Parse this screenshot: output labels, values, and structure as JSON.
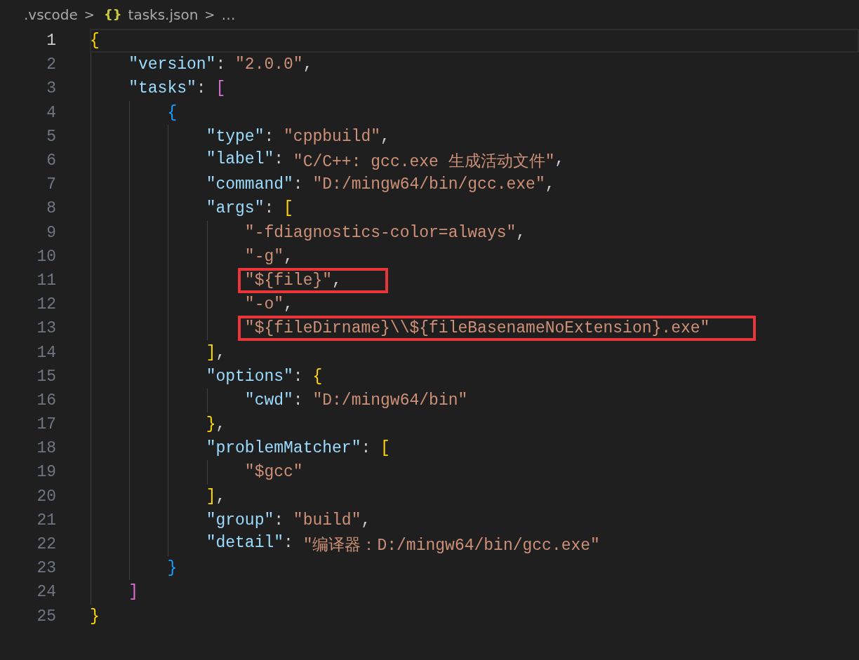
{
  "breadcrumb": {
    "folder": ".vscode",
    "separator_1": ">",
    "file_icon": "{}",
    "file": "tasks.json",
    "separator_2": ">",
    "more": "…"
  },
  "lines": [
    {
      "number": "1",
      "active": true,
      "highlighted": false,
      "tokens": [
        {
          "kind": "bracket",
          "text": "{",
          "color": "#ffd700"
        }
      ],
      "children": [
        {
          "number": "2",
          "active": false,
          "highlighted": false,
          "tokens": [
            {
              "kind": "key",
              "text": "\"version\""
            },
            {
              "kind": "punct",
              "text": ": "
            },
            {
              "kind": "string",
              "text": "\"2.0.0\""
            },
            {
              "kind": "punct",
              "text": ","
            }
          ]
        },
        {
          "number": "3",
          "active": false,
          "highlighted": false,
          "tokens": [
            {
              "kind": "key",
              "text": "\"tasks\""
            },
            {
              "kind": "punct",
              "text": ": "
            },
            {
              "kind": "bracket",
              "text": "[",
              "color": "#da70d6"
            }
          ],
          "children": [
            {
              "number": "4",
              "active": false,
              "highlighted": false,
              "tokens": [
                {
                  "kind": "bracket",
                  "text": "{",
                  "color": "#179fff"
                }
              ],
              "children": [
                {
                  "number": "5",
                  "active": false,
                  "highlighted": false,
                  "tokens": [
                    {
                      "kind": "key",
                      "text": "\"type\""
                    },
                    {
                      "kind": "punct",
                      "text": ": "
                    },
                    {
                      "kind": "string",
                      "text": "\"cppbuild\""
                    },
                    {
                      "kind": "punct",
                      "text": ","
                    }
                  ]
                },
                {
                  "number": "6",
                  "active": false,
                  "highlighted": false,
                  "tokens": [
                    {
                      "kind": "key",
                      "text": "\"label\""
                    },
                    {
                      "kind": "punct",
                      "text": ": "
                    },
                    {
                      "kind": "string",
                      "text": "\"C/C++: gcc.exe 生成活动文件\""
                    },
                    {
                      "kind": "punct",
                      "text": ","
                    }
                  ]
                },
                {
                  "number": "7",
                  "active": false,
                  "highlighted": false,
                  "tokens": [
                    {
                      "kind": "key",
                      "text": "\"command\""
                    },
                    {
                      "kind": "punct",
                      "text": ": "
                    },
                    {
                      "kind": "string",
                      "text": "\"D:/mingw64/bin/gcc.exe\""
                    },
                    {
                      "kind": "punct",
                      "text": ","
                    }
                  ]
                },
                {
                  "number": "8",
                  "active": false,
                  "highlighted": false,
                  "tokens": [
                    {
                      "kind": "key",
                      "text": "\"args\""
                    },
                    {
                      "kind": "punct",
                      "text": ": "
                    },
                    {
                      "kind": "bracket",
                      "text": "[",
                      "color": "#ffd700"
                    }
                  ],
                  "children": [
                    {
                      "number": "9",
                      "active": false,
                      "highlighted": false,
                      "tokens": [
                        {
                          "kind": "string",
                          "text": "\"-fdiagnostics-color=always\""
                        },
                        {
                          "kind": "punct",
                          "text": ","
                        }
                      ]
                    },
                    {
                      "number": "10",
                      "active": false,
                      "highlighted": false,
                      "tokens": [
                        {
                          "kind": "string",
                          "text": "\"-g\""
                        },
                        {
                          "kind": "punct",
                          "text": ","
                        }
                      ]
                    },
                    {
                      "number": "11",
                      "active": false,
                      "highlighted": true,
                      "tokens": [
                        {
                          "kind": "string",
                          "text": "\"${file}\""
                        },
                        {
                          "kind": "punct",
                          "text": ","
                        }
                      ]
                    },
                    {
                      "number": "12",
                      "active": false,
                      "highlighted": false,
                      "tokens": [
                        {
                          "kind": "string",
                          "text": "\"-o\""
                        },
                        {
                          "kind": "punct",
                          "text": ","
                        }
                      ]
                    },
                    {
                      "number": "13",
                      "active": false,
                      "highlighted": true,
                      "tokens": [
                        {
                          "kind": "string",
                          "text": "\"${fileDirname}\\\\${fileBasenameNoExtension}.exe\""
                        }
                      ]
                    }
                  ]
                },
                {
                  "number": "14",
                  "active": false,
                  "highlighted": false,
                  "tokens": [
                    {
                      "kind": "bracket",
                      "text": "]",
                      "color": "#ffd700"
                    },
                    {
                      "kind": "punct",
                      "text": ","
                    }
                  ]
                },
                {
                  "number": "15",
                  "active": false,
                  "highlighted": false,
                  "tokens": [
                    {
                      "kind": "key",
                      "text": "\"options\""
                    },
                    {
                      "kind": "punct",
                      "text": ": "
                    },
                    {
                      "kind": "bracket",
                      "text": "{",
                      "color": "#ffd700"
                    }
                  ],
                  "children": [
                    {
                      "number": "16",
                      "active": false,
                      "highlighted": false,
                      "tokens": [
                        {
                          "kind": "key",
                          "text": "\"cwd\""
                        },
                        {
                          "kind": "punct",
                          "text": ": "
                        },
                        {
                          "kind": "string",
                          "text": "\"D:/mingw64/bin\""
                        }
                      ]
                    }
                  ]
                },
                {
                  "number": "17",
                  "active": false,
                  "highlighted": false,
                  "tokens": [
                    {
                      "kind": "bracket",
                      "text": "}",
                      "color": "#ffd700"
                    },
                    {
                      "kind": "punct",
                      "text": ","
                    }
                  ]
                },
                {
                  "number": "18",
                  "active": false,
                  "highlighted": false,
                  "tokens": [
                    {
                      "kind": "key",
                      "text": "\"problemMatcher\""
                    },
                    {
                      "kind": "punct",
                      "text": ": "
                    },
                    {
                      "kind": "bracket",
                      "text": "[",
                      "color": "#ffd700"
                    }
                  ],
                  "children": [
                    {
                      "number": "19",
                      "active": false,
                      "highlighted": false,
                      "tokens": [
                        {
                          "kind": "string",
                          "text": "\"$gcc\""
                        }
                      ]
                    }
                  ]
                },
                {
                  "number": "20",
                  "active": false,
                  "highlighted": false,
                  "tokens": [
                    {
                      "kind": "bracket",
                      "text": "]",
                      "color": "#ffd700"
                    },
                    {
                      "kind": "punct",
                      "text": ","
                    }
                  ]
                },
                {
                  "number": "21",
                  "active": false,
                  "highlighted": false,
                  "tokens": [
                    {
                      "kind": "key",
                      "text": "\"group\""
                    },
                    {
                      "kind": "punct",
                      "text": ": "
                    },
                    {
                      "kind": "string",
                      "text": "\"build\""
                    },
                    {
                      "kind": "punct",
                      "text": ","
                    }
                  ]
                },
                {
                  "number": "22",
                  "active": false,
                  "highlighted": false,
                  "tokens": [
                    {
                      "kind": "key",
                      "text": "\"detail\""
                    },
                    {
                      "kind": "punct",
                      "text": ": "
                    },
                    {
                      "kind": "string",
                      "text": "\"编译器：D:/mingw64/bin/gcc.exe\""
                    }
                  ]
                }
              ]
            },
            {
              "number": "23",
              "active": false,
              "highlighted": false,
              "tokens": [
                {
                  "kind": "bracket",
                  "text": "}",
                  "color": "#179fff"
                }
              ]
            }
          ]
        },
        {
          "number": "24",
          "active": false,
          "highlighted": false,
          "tokens": [
            {
              "kind": "bracket",
              "text": "]",
              "color": "#da70d6"
            }
          ]
        }
      ]
    },
    {
      "number": "25",
      "active": false,
      "highlighted": false,
      "tokens": [
        {
          "kind": "bracket",
          "text": "}",
          "color": "#ffd700"
        }
      ]
    }
  ]
}
